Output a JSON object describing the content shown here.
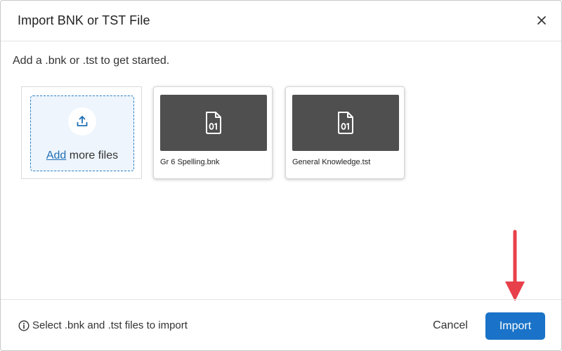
{
  "dialog": {
    "title": "Import BNK or TST File",
    "close_icon": "close-icon"
  },
  "body": {
    "intro": "Add a .bnk or .tst to get started.",
    "add_tile": {
      "icon": "upload-icon",
      "link_label": "Add",
      "rest_label": " more files"
    },
    "files": [
      {
        "name": "Gr 6 Spelling.bnk",
        "icon": "binary-file-icon"
      },
      {
        "name": "General Knowledge.tst",
        "icon": "binary-file-icon"
      }
    ]
  },
  "footer": {
    "hint_icon": "info-icon",
    "hint": "Select .bnk and .tst files to import",
    "cancel_label": "Cancel",
    "import_label": "Import"
  },
  "colors": {
    "primary": "#1a73c8",
    "link": "#1f6fb5",
    "thumbnail": "#4f4f4f",
    "annotation_arrow": "#e8404a"
  }
}
